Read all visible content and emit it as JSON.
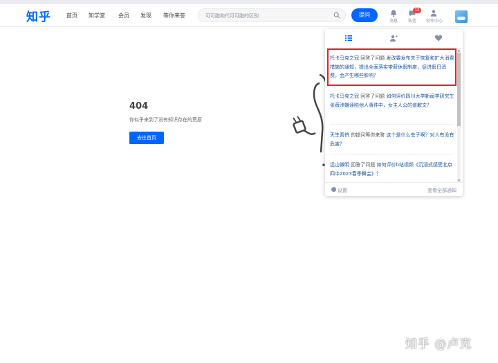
{
  "header": {
    "logo": "知乎",
    "nav": [
      "首页",
      "知学堂",
      "会员",
      "发现",
      "等你来答"
    ],
    "search_placeholder": "可可脂和代可可脂的区别",
    "ask_label": "提问",
    "icons": [
      {
        "icon": "bell-icon",
        "label": "消息"
      },
      {
        "icon": "chat-icon",
        "label": "私信"
      },
      {
        "icon": "user-icon",
        "label": "创作中心"
      }
    ],
    "badge": "12"
  },
  "error": {
    "code": "404",
    "message": "你似乎来到了没有知识存在的荒原",
    "button": "去往首页"
  },
  "notifications": {
    "items": [
      {
        "user": "托卡马克之冠",
        "action": " 回答了问题 ",
        "question": "发改委发布关于恢复和扩大消费措施的通知，提出全面落实带薪休假制度，促进假日消费，会产生哪些影响？"
      },
      {
        "user": "托卡马克之冠",
        "action": " 回答了问题 ",
        "question": "如何评价四川大学新闻学研究生张薇涉嫌诬陷他人事件中，女主人公的道歉文？"
      },
      {
        "user": "天生吾侪",
        "action": " 的提问等你来答 ",
        "question": "这个是什么虫子啊？对人有没有危害？"
      },
      {
        "user": "远山微明",
        "action": " 回答了问题 ",
        "question": "如何评价b站视频《沉浸式感受北京四中2023春季舞会》？"
      }
    ],
    "settings": "设置",
    "view_all": "查看全部通知"
  },
  "watermark": "知乎 @卢克"
}
